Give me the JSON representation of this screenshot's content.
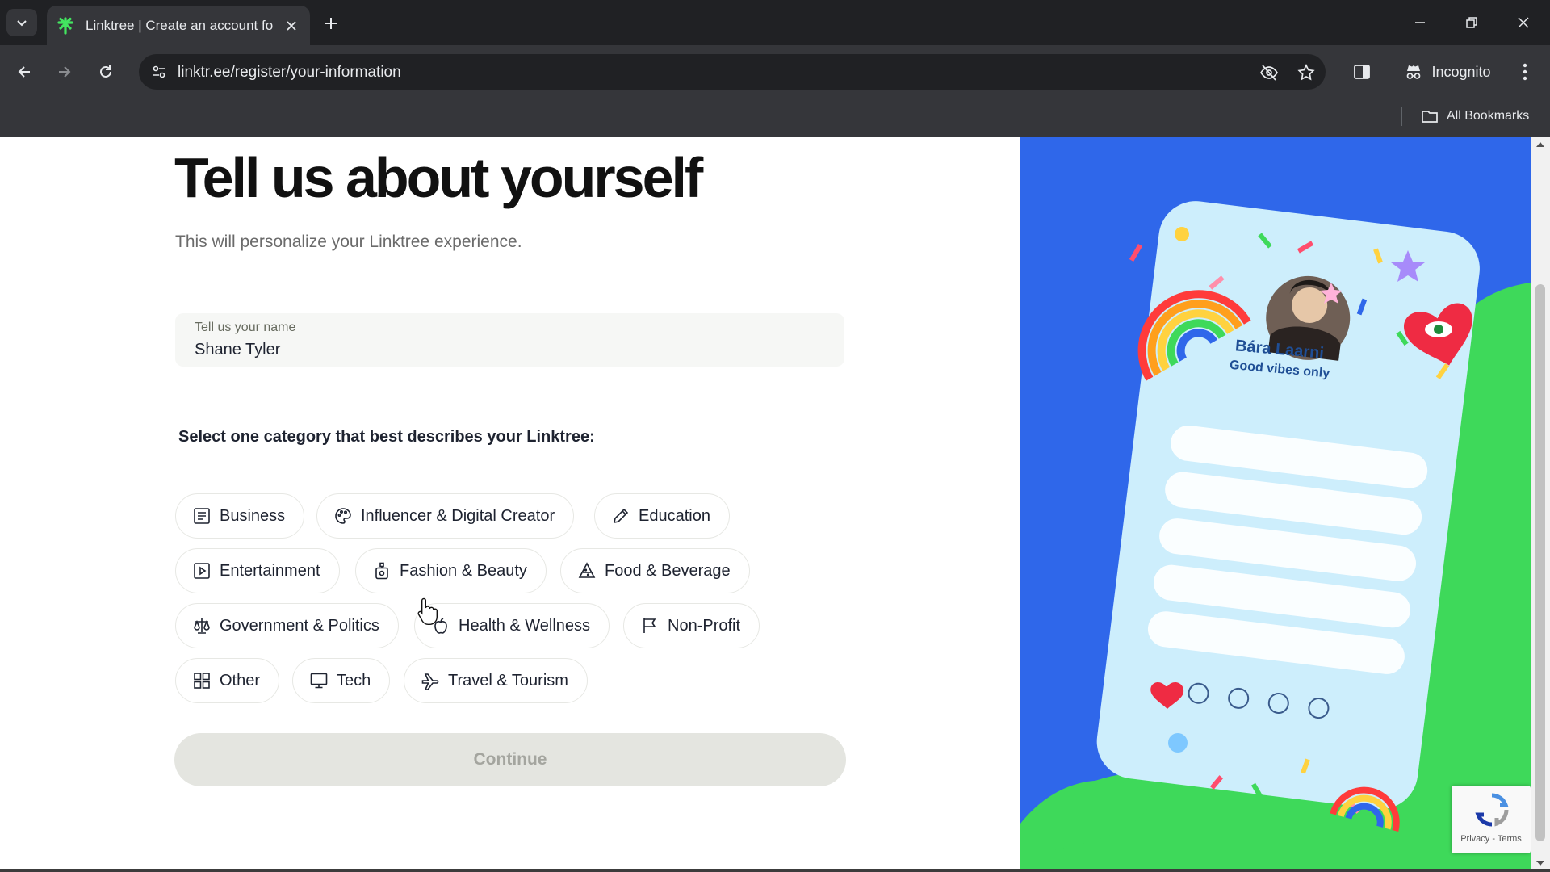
{
  "browser": {
    "tab_title": "Linktree | Create an account for",
    "url": "linktr.ee/register/your-information",
    "profile_label": "Incognito",
    "bookmarks_label": "All Bookmarks"
  },
  "page": {
    "title": "Tell us about yourself",
    "subtitle": "This will personalize your Linktree experience.",
    "name_field": {
      "label": "Tell us your name",
      "value": "Shane Tyler"
    },
    "category_prompt": "Select one category that best describes your Linktree:",
    "categories": [
      {
        "label": "Business",
        "icon": "business-icon"
      },
      {
        "label": "Influencer & Digital Creator",
        "icon": "palette-icon"
      },
      {
        "label": "Education",
        "icon": "pencil-icon"
      },
      {
        "label": "Entertainment",
        "icon": "play-icon"
      },
      {
        "label": "Fashion & Beauty",
        "icon": "perfume-icon"
      },
      {
        "label": "Food & Beverage",
        "icon": "food-icon"
      },
      {
        "label": "Government & Politics",
        "icon": "scales-icon"
      },
      {
        "label": "Health & Wellness",
        "icon": "apple-icon"
      },
      {
        "label": "Non-Profit",
        "icon": "flag-icon"
      },
      {
        "label": "Other",
        "icon": "grid-icon"
      },
      {
        "label": "Tech",
        "icon": "monitor-icon"
      },
      {
        "label": "Travel & Tourism",
        "icon": "plane-icon"
      }
    ],
    "continue_label": "Continue",
    "preview": {
      "name": "Bára Laarni",
      "tagline": "Good vibes only"
    },
    "recaptcha_links": "Privacy - Terms"
  },
  "colors": {
    "illustration_bg": "#2f67ea",
    "illustration_green": "#3ed95a",
    "phone_card": "#cdeefc",
    "continue_disabled": "#e4e5e0"
  }
}
